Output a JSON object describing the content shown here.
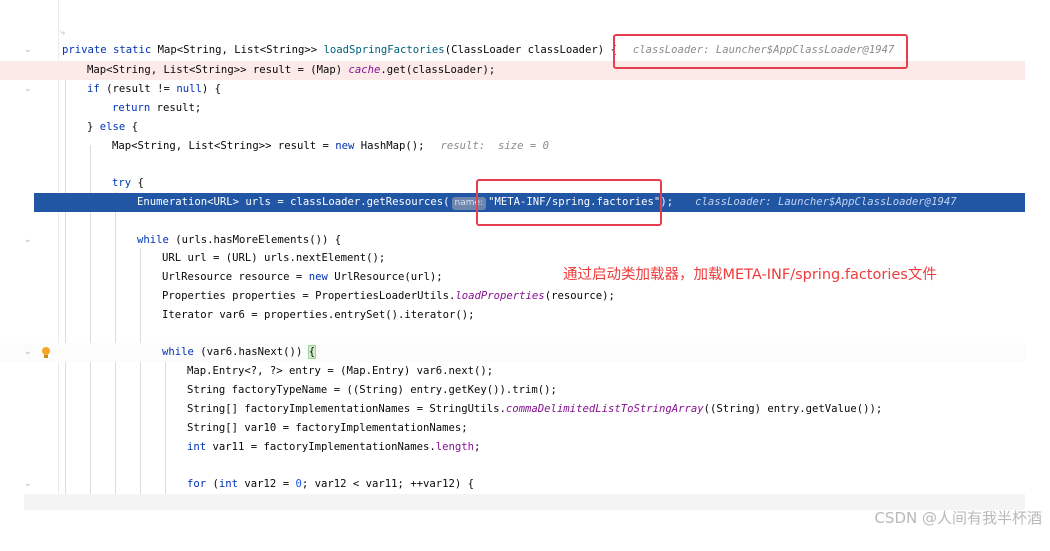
{
  "editor": {
    "top_hint": "⤷",
    "lines": {
      "l1": {
        "pre": "private static ",
        "type": "Map<String, List<String>> ",
        "method": "loadSpringFactories",
        "args": "(ClassLoader classLoader) {",
        "debug": "classLoader: Launcher$AppClassLoader@1947"
      },
      "l2": {
        "pre": "Map<String, List<String>> result = (Map) ",
        "field": "cache",
        "post": ".get(classLoader);"
      },
      "l3": {
        "kw": "if",
        "post1": " (result != ",
        "kw2": "null",
        "post2": ") {"
      },
      "l4": {
        "kw": "return",
        "post": " result;"
      },
      "l5": {
        "pre": "} ",
        "kw": "else",
        "post": " {"
      },
      "l6": {
        "pre": "Map<String, List<String>> result = ",
        "kw": "new",
        "post": " HashMap();",
        "debug": "result:  size = 0"
      },
      "l7": {
        "kw": "try",
        "post": " {"
      },
      "l8": {
        "pre": "Enumeration<URL> urls = classLoader.getResources(",
        "hint": "name:",
        "str": "\"META-INF/spring.factories\"",
        "post": ");",
        "debug": "classLoader: Launcher$AppClassLoader@1947"
      },
      "l9": {
        "kw": "while",
        "post": " (urls.hasMoreElements()) {"
      },
      "l10": {
        "text": "URL url = (URL) urls.nextElement();"
      },
      "l11": {
        "pre": "UrlResource resource = ",
        "kw": "new",
        "post": " UrlResource(url);"
      },
      "l12": {
        "pre": "Properties properties = PropertiesLoaderUtils.",
        "it": "loadProperties",
        "post": "(resource);"
      },
      "l13": {
        "text": "Iterator var6 = properties.entrySet().iterator();"
      },
      "l14": {
        "kw": "while",
        "post": " (var6.hasNext()) ",
        "brace": "{"
      },
      "l15": {
        "text": "Map.Entry<?, ?> entry = (Map.Entry) var6.next();"
      },
      "l16": {
        "text": "String factoryTypeName = ((String) entry.getKey()).trim();"
      },
      "l17": {
        "pre": "String[] factoryImplementationNames = StringUtils.",
        "it": "commaDelimitedListToStringArray",
        "post": "((String) entry.getValue());"
      },
      "l18": {
        "text": "String[] var10 = factoryImplementationNames;"
      },
      "l19": {
        "kw": "int",
        "post": " var11 = factoryImplementationNames.",
        "field": "length",
        "post2": ";"
      },
      "l20": {
        "kw": "for",
        "pre": " (",
        "kw2": "int",
        "post1": " var12 = ",
        "num": "0",
        "post2": "; var12 < var11; ++var12) {"
      }
    }
  },
  "annotation": "通过启动类加载器，加载META-INF/spring.factories文件",
  "watermark": "CSDN @人间有我半杯酒",
  "colors": {
    "selection": "#2156a5",
    "red_box": "#e53e51",
    "annotation": "#ef3b3b",
    "keyword": "#0033b3",
    "string": "#067d17"
  }
}
